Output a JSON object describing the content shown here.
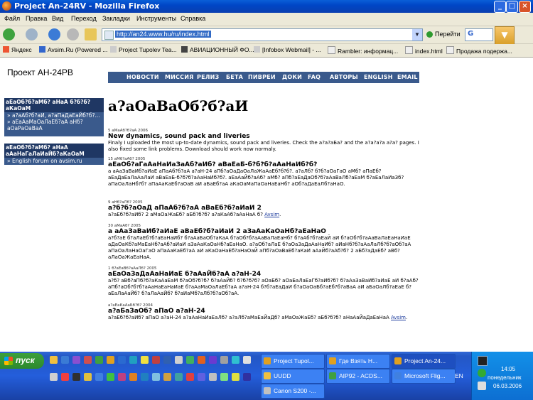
{
  "window": {
    "title": "Project An-24RV - Mozilla Firefox"
  },
  "menu": [
    "Файл",
    "Правка",
    "Вид",
    "Переход",
    "Закладки",
    "Инструменты",
    "Справка"
  ],
  "navbar": {
    "url": "http://an24.www.hu/ru/index.html",
    "go_label": "Перейти",
    "search_label": "G"
  },
  "bookmarks": [
    "Яндекс",
    "Avsim.Ru (Powered ...",
    "Project Tupolev Tea...",
    "АВИАЦИОННЫЙ ФО...",
    "[Infobox Webmail] - ...",
    "Rambler: информац...",
    "index.html",
    "Продажа подержа..."
  ],
  "site": {
    "title": "Проект АН-24РВ",
    "topnav": [
      "НОВОСТИ",
      "МИССИЯ",
      "РЕЛИЗ",
      "БЕТА",
      "ПИВРЕИ",
      "ДОКИ",
      "FAQ",
      "АВТОРЫ",
      "ENGLISH",
      "EMAIL"
    ],
    "side1": {
      "head": "аЕаОб?б?аМб? аНаА б?б?б?аКаОаМ",
      "items": [
        "» а?аАб?б?аИ, а?аПаДаЕаЙб?б?...",
        "» аЕаАаМаОаЛаЕб?аА аНб?аОаРаОаВаА"
      ]
    },
    "side2": {
      "head": "аЕаОб?б?аМб? аНаА аАаНаГаЛаИаЙб?аКаОаМ",
      "items": [
        "» English forum on avsim.ru"
      ]
    },
    "heading": "а?аОаВаОб?б?аИ",
    "news": [
      {
        "date": "5 аМаАб?б?аА 2006",
        "title": "New dynamics, sound pack and liveries",
        "body": "Finaly I uploaded the most up-to-date dynamics, sound pack and liveries. Check the а?а?аБа? and the а?а?а?а а?а? pages. I also fixed some link problems. Download should work now normaly."
      },
      {
        "date": "15 аМб?аАб? 2005",
        "title": "аЕаОб?аГаАаНаИаЗаАб?аИб? аВаЕаБ-б?б?б?аАаНаИб?б?",
        "body": "а аАаЗаВаИб?аИаЕ аПаАб?б?аА а?аН-24 аПб?аОаДаОаЛаЖаАаЕб?б?б?. а?аЛб? б?б?аОаГаО аМб? аПаЕб?аЕаДаЕаЛаАаЛаИ аВаЕаБ-б?б?б?аАаНаИб?б?. аЕаАаЙб?аАб? аМб? аПб?аЕаДаОб?б?аАаВаЛб?аЕаМ б?аЕаЛаИаЗб? аПаОаЛаНб?б? аПаАаКаЕб?аОаВ аИ аБаЕб?аА аКаОаМаПаОаНаЕаНб? аОб?аДаЕаЛб?аНаО."
      },
      {
        "date": "9 аНб?аЛб? 2005",
        "title": "а?б?б?аОаД аПаАб?б?аА аВаЕб?б?аИаИ 2",
        "body": "а?аЕб?б?аИб? 2 аМаОаЖаЕб? аБб?б?б? а?аКаАб?аАаНаА б? Avsim."
      },
      {
        "date": "30 аМаАб? 2005",
        "title": "а аАаЗаВаИб?аИаЕ аВаЕб?б?аИаИ 2 аЗаАаКаОаНб?аЕаНаО",
        "body": "а?б?аЕ б?аЛаЕб?б?аЕаНаИб? б?аАаБаОб?аКаА б?аОб?б?аАаВаЛаЕаНб? б?аАб?б?аЕаЙ аИ б?аОб?б?аАаВаЛаЕаНаИаЕ аДаОаКб?аМаЕаНб?аАб?аИаИ аЗаАаКаОаНб?аЕаНаО. а?аОб?аЛаЕ б?аОаЗаДаАаНаИб? аИаНб?б?аАаЛаЛб?б?аОб?аА аПаОаЛаНаОаГаО аПаАаКаЕб?аА аИ аКаОаНаЕб?аНаОаЙ аПб?аОаВаЕб?аКаИ аАаЙб?аАб?б? 2 аБб?аДаЕб? аВб?аЛаОаЖаЕаНаА."
      },
      {
        "date": "1 б?аЕаВб?аАаЛб? 2005",
        "title": "аЕаОаЗаДаАаНаИаЕ б?аАаЙб?аА а?аН-24",
        "body": "а?б? аВб?аПб?б?аКаАаЕаМ б?аОб?б?б? б?аАаЙб? б?б?б?б? аОаБб? аОаБаЛаЕаГб?аИб?б? б?аАаЗаВаИб?аИаЕ аИ б?аАб?аПб?аОб?б?б?аАаНаЕаНаИаЕ б?аАаМаОаЛаЕб?аА а?аН-24 б?б?аЕаДаИ б?аОаОаБб?аЕб?б?аВаА аИ аБаОаЛб?аЕаЕ б?аЕаЛаАаЙб? б?аЛаАаЙб? б?аИаМб?аЛб?б?аОб?аА."
      },
      {
        "date": "а?аЕаКаАаБб?б? 2004",
        "title": "а?аБаЗаОб? аПаО а?аН-24",
        "body": "а?аЕб?б?аИб? аПаО а?аН-24 а?аАаНаИаЕаЛб? а?аЛб?аМаЕаЙаДб? аМаОаЖаЕб? аБб?б?б? аНаАаЙаДаЕаНаА Avsim."
      }
    ]
  },
  "taskbar": {
    "start": "пуск",
    "buttons_row1": [
      "Project Tupol...",
      "Где Взять Н...",
      "Project An-24..."
    ],
    "buttons_row2": [
      "UUDD",
      "AIP92 - ACDS...",
      "Microsoft Flig..."
    ],
    "buttons_row3": [
      "Canon S200 -..."
    ],
    "lang": "EN",
    "time": "14:05",
    "day": "понедельник",
    "date": "06.03.2006"
  },
  "colors": {
    "site_nav": "#3a5a8c",
    "site_nav_dark": "#1f3763",
    "taskbar": "#245edb",
    "start": "#2d8a2d"
  }
}
